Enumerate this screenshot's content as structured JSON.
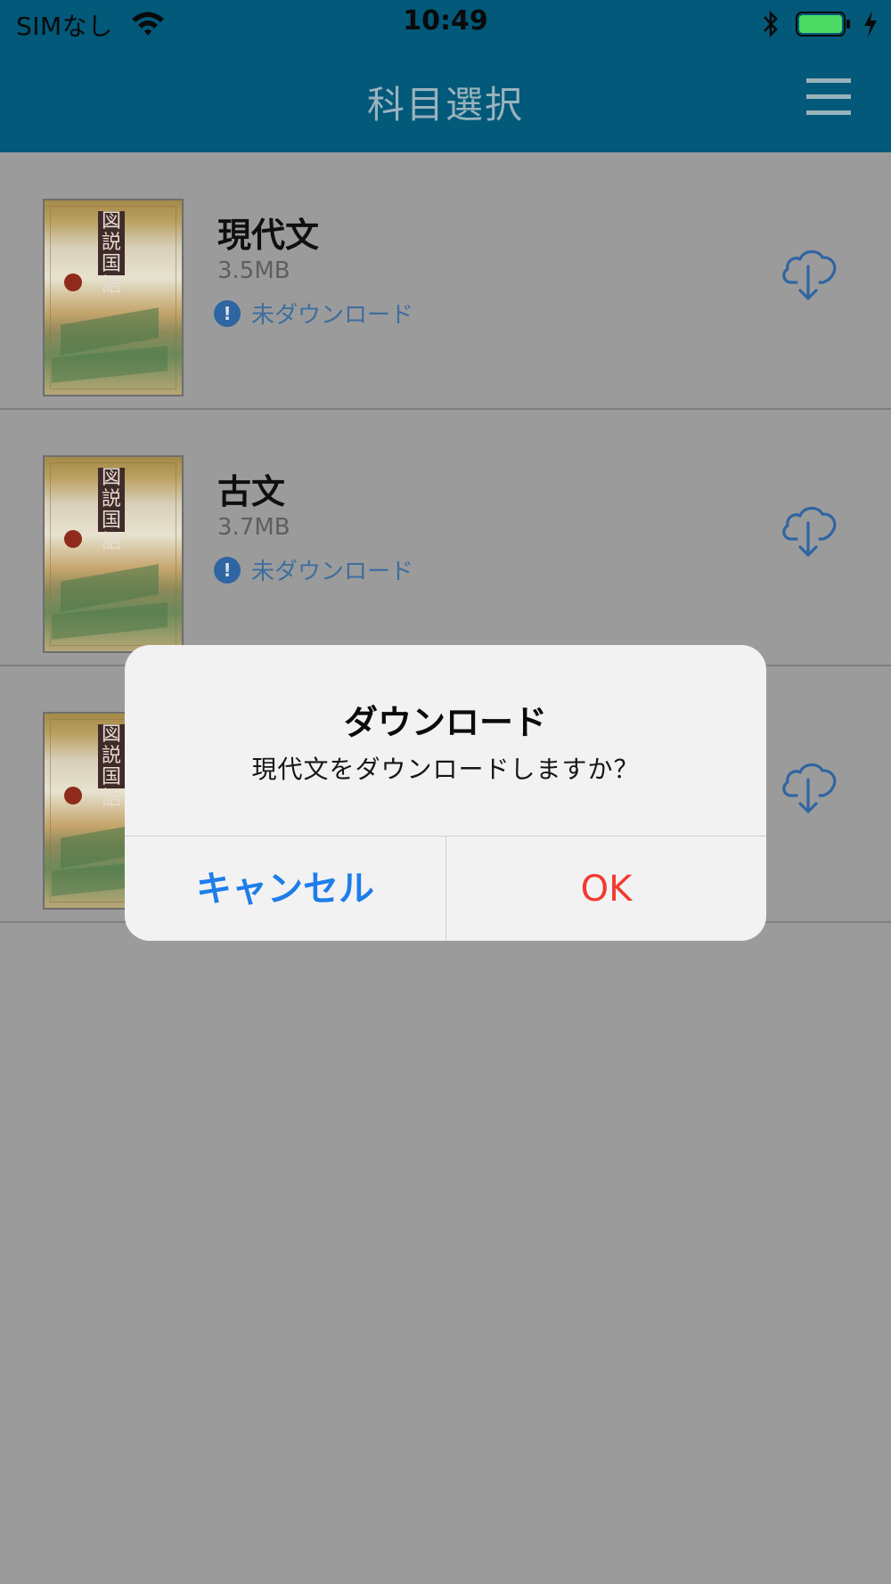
{
  "status_bar": {
    "carrier": "SIMなし",
    "time": "10:49",
    "icons": [
      "wifi-icon",
      "bluetooth-icon",
      "battery-icon",
      "charging-bolt-icon"
    ],
    "battery_color": "#4cd964"
  },
  "nav": {
    "title": "科目選択",
    "menu_icon": "hamburger-menu-icon",
    "background": "#025979"
  },
  "subjects": [
    {
      "title": "現代文",
      "size": "3.5MB",
      "status": "未ダウンロード",
      "action_icon": "cloud-download-icon"
    },
    {
      "title": "古文",
      "size": "3.7MB",
      "status": "未ダウンロード",
      "action_icon": "cloud-download-icon"
    },
    {
      "title": "",
      "size": "",
      "status": "",
      "action_icon": "cloud-download-icon"
    }
  ],
  "thumbnail": {
    "cover_text": "図説国語"
  },
  "dialog": {
    "title": "ダウンロード",
    "message": "現代文をダウンロードしますか？",
    "cancel_label": "キャンセル",
    "ok_label": "OK",
    "cancel_color": "#1d7dea",
    "ok_color": "#f23a2f"
  }
}
